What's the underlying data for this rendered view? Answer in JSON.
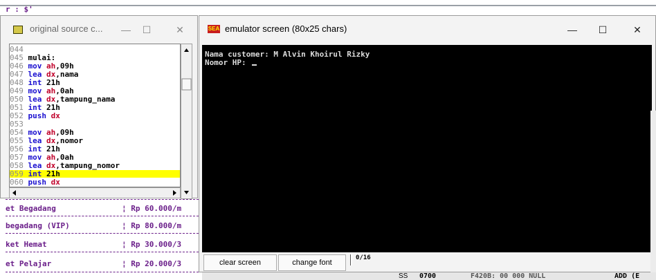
{
  "background_console": {
    "top_text": "r : $'",
    "rows": [
      {
        "name": "et Begadang",
        "price": "Rp 60.000/m"
      },
      {
        "name": "begadang (VIP)",
        "price": "Rp 80.000/m"
      },
      {
        "name": "ket Hemat",
        "price": "Rp 30.000/3"
      },
      {
        "name": "et Pelajar",
        "price": "Rp 20.000/3"
      }
    ]
  },
  "source_window": {
    "title": "original source c...",
    "minimize_icon": "—",
    "maximize_icon": "☐",
    "close_icon": "✕",
    "code_lines": [
      {
        "num": "044",
        "kw": "",
        "reg": "",
        "rest": "",
        "highlight": false
      },
      {
        "num": "045",
        "kw": "",
        "reg": "",
        "rest": "mulai:",
        "highlight": false
      },
      {
        "num": "046",
        "kw": "mov",
        "reg": "ah",
        "rest": ",09h",
        "highlight": false
      },
      {
        "num": "047",
        "kw": "lea",
        "reg": "dx",
        "rest": ",nama",
        "highlight": false
      },
      {
        "num": "048",
        "kw": "int",
        "reg": "",
        "rest": "21h",
        "highlight": false
      },
      {
        "num": "049",
        "kw": "mov",
        "reg": "ah",
        "rest": ",0ah",
        "highlight": false
      },
      {
        "num": "050",
        "kw": "lea",
        "reg": "dx",
        "rest": ",tampung_nama",
        "highlight": false
      },
      {
        "num": "051",
        "kw": "int",
        "reg": "",
        "rest": "21h",
        "highlight": false
      },
      {
        "num": "052",
        "kw": "push",
        "reg": "dx",
        "rest": "",
        "highlight": false
      },
      {
        "num": "053",
        "kw": "",
        "reg": "",
        "rest": "",
        "highlight": false
      },
      {
        "num": "054",
        "kw": "mov",
        "reg": "ah",
        "rest": ",09h",
        "highlight": false
      },
      {
        "num": "055",
        "kw": "lea",
        "reg": "dx",
        "rest": ",nomor",
        "highlight": false
      },
      {
        "num": "056",
        "kw": "int",
        "reg": "",
        "rest": "21h",
        "highlight": false
      },
      {
        "num": "057",
        "kw": "mov",
        "reg": "ah",
        "rest": ",0ah",
        "highlight": false
      },
      {
        "num": "058",
        "kw": "lea",
        "reg": "dx",
        "rest": ",tampung_nomor",
        "highlight": false
      },
      {
        "num": "059",
        "kw": "int",
        "reg": "",
        "rest": "21h",
        "highlight": true
      },
      {
        "num": "060",
        "kw": "push",
        "reg": "dx",
        "rest": "",
        "highlight": false
      }
    ]
  },
  "emulator_window": {
    "icon_text": "SEA",
    "title": "emulator screen (80x25 chars)",
    "minimize_icon": "—",
    "maximize_icon": "☐",
    "close_icon": "✕",
    "screen_lines": [
      "Nama customer: M Alvin Khoirul Rizky",
      "Nomor HP: "
    ],
    "clear_screen_label": "clear screen",
    "change_font_label": "change font",
    "progress_text": "0/16"
  },
  "background_bottom": {
    "ss_label": "SS",
    "ss_value": "0700",
    "mem_text": "F420B: 00 000 NULL",
    "right_text": "ADD (E"
  },
  "colors": {
    "console_purple": "#6b1f8a",
    "highlight_yellow": "#ffff00",
    "keyword_blue": "#1a0fd0",
    "register_red": "#c0002a"
  }
}
